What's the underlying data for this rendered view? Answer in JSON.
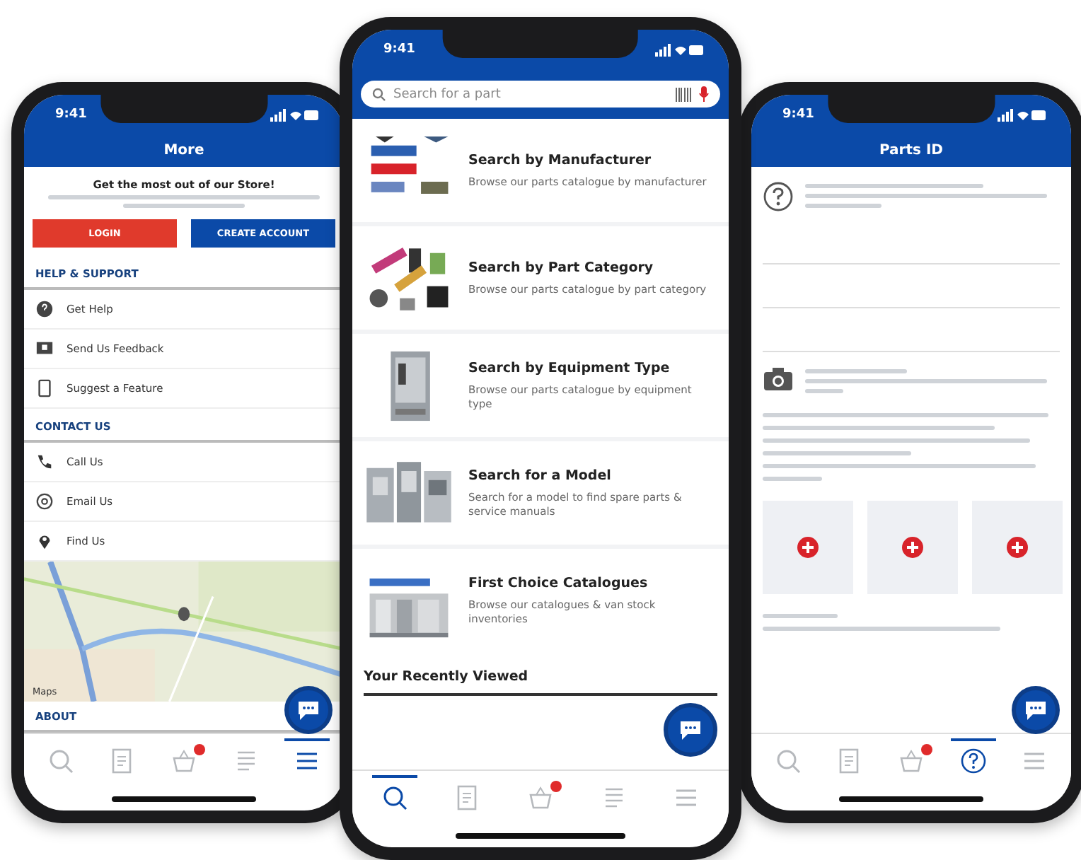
{
  "left_phone": {
    "status_time": "9:41",
    "title": "More",
    "promo_heading": "Get the most out of our Store!",
    "buttons": [
      {
        "label": "LOGIN",
        "kind": "primary"
      },
      {
        "label": "CREATE ACCOUNT",
        "kind": "secondary"
      }
    ],
    "sections": [
      {
        "heading": "HELP & SUPPORT",
        "items": [
          {
            "label": "Get Help",
            "kind": "help"
          },
          {
            "label": "Send Us Feedback",
            "kind": "feedback"
          },
          {
            "label": "Suggest a Feature",
            "kind": "feature"
          }
        ]
      },
      {
        "heading": "CONTACT US",
        "items": [
          {
            "label": "Call Us",
            "kind": "phone"
          },
          {
            "label": "Email Us",
            "kind": "email"
          },
          {
            "label": "Find Us",
            "kind": "location"
          }
        ]
      }
    ],
    "map_attribution": "Maps",
    "footer_heading": "ABOUT",
    "tabs": [
      {
        "kind": "search",
        "selected": false,
        "badge": false
      },
      {
        "kind": "document",
        "selected": false,
        "badge": false
      },
      {
        "kind": "basket",
        "selected": false,
        "badge": true
      },
      {
        "kind": "list",
        "selected": false,
        "badge": false
      },
      {
        "kind": "menu",
        "selected": true,
        "badge": false
      }
    ]
  },
  "center_phone": {
    "status_time": "9:41",
    "search": {
      "placeholder": "Search for a part"
    },
    "options": [
      {
        "title": "Search by Manufacturer",
        "description": "Browse our parts catalogue by manufacturer"
      },
      {
        "title": "Search by Part Category",
        "description": "Browse our parts catalogue by part category"
      },
      {
        "title": "Search by Equipment Type",
        "description": "Browse our parts catalogue by equipment type"
      },
      {
        "title": "Search for a Model",
        "description": "Search for a model to find spare parts & service manuals"
      },
      {
        "title": "First Choice Catalogues",
        "description": "Browse our catalogues & van stock inventories"
      }
    ],
    "recent_heading": "Your Recently Viewed",
    "tabs": [
      {
        "kind": "search",
        "selected": true,
        "badge": false
      },
      {
        "kind": "document",
        "selected": false,
        "badge": false
      },
      {
        "kind": "basket",
        "selected": false,
        "badge": true
      },
      {
        "kind": "list",
        "selected": false,
        "badge": false
      },
      {
        "kind": "menu",
        "selected": false,
        "badge": false
      }
    ]
  },
  "right_phone": {
    "status_time": "9:41",
    "title": "Parts ID",
    "tabs": [
      {
        "kind": "search",
        "selected": false,
        "badge": false
      },
      {
        "kind": "document",
        "selected": false,
        "badge": false
      },
      {
        "kind": "basket",
        "selected": false,
        "badge": true
      },
      {
        "kind": "question",
        "selected": true,
        "badge": false
      },
      {
        "kind": "menu",
        "selected": false,
        "badge": false
      }
    ]
  }
}
